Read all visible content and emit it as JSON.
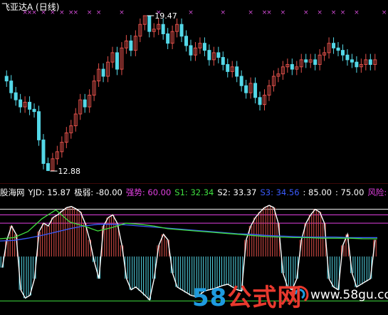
{
  "title": "飞亚达A (日线)",
  "price_panel": {
    "high_label": "19.47",
    "low_label": "12.88",
    "colors": {
      "up": "#e0504a",
      "down": "#54d8e8",
      "marker": "#d24cd6"
    }
  },
  "indicator_bar": [
    {
      "key": "name",
      "text": "股海网",
      "color": "#ffffff"
    },
    {
      "key": "yjd",
      "text": "YJD: 15.87",
      "color": "#ffffff"
    },
    {
      "key": "jiruo",
      "text": "极弱: -80.00",
      "color": "#ffffff"
    },
    {
      "key": "qiangshi",
      "text": "强势: 60.00",
      "color": "#e040e0"
    },
    {
      "key": "s1",
      "text": "S1: 32.34",
      "color": "#40e040"
    },
    {
      "key": "s2",
      "text": "S2: 33.37",
      "color": "#ffffff"
    },
    {
      "key": "s3",
      "text": "S3: 34.56",
      "color": "#3b5cff"
    },
    {
      "key": "v85",
      "text": ": 85.00",
      "color": "#ffffff"
    },
    {
      "key": "v75",
      "text": ": 75.00",
      "color": "#ffffff"
    },
    {
      "key": "risk",
      "text": "风险:",
      "color": "#e040e0"
    }
  ],
  "watermark": {
    "num": "58",
    "text": "公式网",
    "url": "www.58gu.com"
  },
  "chart_data": {
    "type": "candlestick+indicator",
    "price_series": [
      16.7,
      16.2,
      15.9,
      15.6,
      15.8,
      15.5,
      15.4,
      14.2,
      13.2,
      12.9,
      13.4,
      13.7,
      14.1,
      14.5,
      14.8,
      15.3,
      15.9,
      15.6,
      16.1,
      16.7,
      17.2,
      16.9,
      17.5,
      17.9,
      17.2,
      18.1,
      18.4,
      18.0,
      18.6,
      19.1,
      19.47,
      18.8,
      18.9,
      19.1,
      18.7,
      18.3,
      18.8,
      19.1,
      18.6,
      18.2,
      17.8,
      18.1,
      18.3,
      18.0,
      17.6,
      17.9,
      17.7,
      17.4,
      17.1,
      17.3,
      16.9,
      16.5,
      16.2,
      16.6,
      16.0,
      15.7,
      16.1,
      16.5,
      16.9,
      17.0,
      17.3,
      17.4,
      17.2,
      17.3,
      17.6,
      17.5,
      17.6,
      17.4,
      17.8,
      17.9,
      18.3,
      18.1,
      18.0,
      17.8,
      17.6,
      17.5,
      17.3,
      17.4,
      17.6,
      17.4,
      17.6
    ],
    "markers": [
      4,
      5,
      6,
      8,
      10,
      12,
      14,
      15,
      18,
      20,
      25,
      33,
      40,
      47,
      53,
      56,
      57,
      60,
      65,
      68,
      71,
      73,
      76,
      82
    ],
    "indicator": {
      "yjd_bars": [
        -20,
        30,
        55,
        40,
        -60,
        -75,
        -70,
        -40,
        45,
        60,
        55,
        70,
        75,
        82,
        88,
        90,
        86,
        80,
        60,
        30,
        -10,
        -40,
        55,
        70,
        75,
        60,
        20,
        -40,
        -60,
        -55,
        -62,
        -70,
        -78,
        -40,
        20,
        40,
        30,
        -30,
        -55,
        -60,
        -65,
        -70,
        -72,
        -68,
        -62,
        -60,
        -58,
        -55,
        -52,
        -50,
        -55,
        -60,
        -62,
        30,
        55,
        70,
        80,
        88,
        92,
        88,
        60,
        -30,
        -55,
        -60,
        -40,
        30,
        60,
        75,
        85,
        80,
        60,
        -40,
        -55,
        -60,
        20,
        40,
        -30,
        -55,
        -50,
        -45,
        -40,
        30
      ],
      "s1": [
        32,
        34,
        45,
        68,
        84,
        62,
        55,
        46,
        52,
        60,
        58,
        55,
        50,
        48,
        46,
        44,
        42,
        40,
        38,
        36,
        35,
        34,
        34,
        33,
        33,
        33,
        32,
        32
      ],
      "s3": [
        28,
        29,
        33,
        38,
        44,
        50,
        55,
        58,
        58,
        57,
        55,
        53,
        51,
        49,
        47,
        45,
        43,
        41,
        40,
        38,
        37,
        36,
        35,
        35,
        35,
        34,
        34,
        34
      ],
      "levels": {
        "strong": 60,
        "weak": -80,
        "l85": 85,
        "l75": 75
      }
    }
  }
}
